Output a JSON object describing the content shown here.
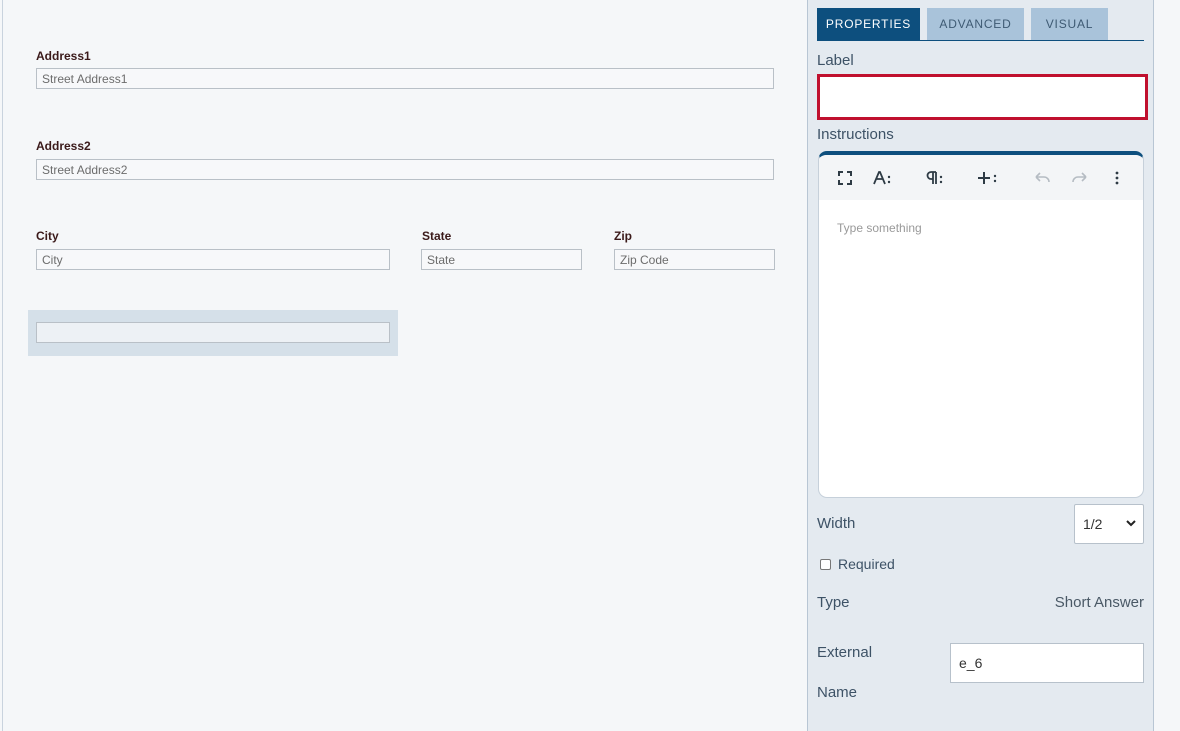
{
  "form": {
    "address1": {
      "label": "Address1",
      "placeholder": "Street Address1"
    },
    "address2": {
      "label": "Address2",
      "placeholder": "Street Address2"
    },
    "city": {
      "label": "City",
      "placeholder": "City"
    },
    "state": {
      "label": "State",
      "placeholder": "State"
    },
    "zip": {
      "label": "Zip",
      "placeholder": "Zip Code"
    }
  },
  "panel": {
    "tabs": [
      {
        "label": "PROPERTIES",
        "active": true
      },
      {
        "label": "ADVANCED",
        "active": false
      },
      {
        "label": "VISUAL",
        "active": false
      }
    ],
    "label_title": "Label",
    "label_value": "",
    "instructions_title": "Instructions",
    "editor_placeholder": "Type something",
    "toolbar_icons": [
      "fullscreen-icon",
      "font-size-icon",
      "paragraph-icon",
      "insert-icon",
      "undo-icon",
      "redo-icon",
      "more-icon"
    ],
    "width_title": "Width",
    "width_value": "1/2",
    "required_label": "Required",
    "required_checked": false,
    "type_title": "Type",
    "type_value": "Short Answer",
    "external_title_1": "External",
    "external_title_2": "Name",
    "external_value": "e_6"
  },
  "colors": {
    "accent": "#0d4f7e",
    "error_border": "#c0102e",
    "inactive_tab": "#a9c3da",
    "panel_bg": "#e4eaf0"
  }
}
